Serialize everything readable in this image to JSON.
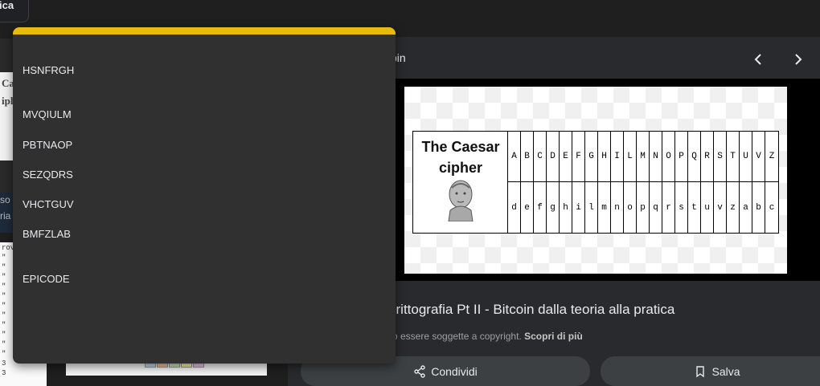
{
  "background": {
    "top_chip_text": "ica",
    "thumb1_lines": [
      "Ca",
      "iph"
    ],
    "thumb2_lines": [
      "so",
      "ria"
    ],
    "doc_lines": [
      "rova",
      "\"",
      "\"",
      "\"",
      "\"",
      "\"",
      "\"",
      "\"",
      "\"",
      "\"",
      "\"",
      "\"",
      "3",
      "3"
    ]
  },
  "dropdown": {
    "items": [
      "HSNFRGH",
      "MVQIULM",
      "PBTNAOP",
      "SEZQDRS",
      "VHCTGUV",
      "BMFZLAB",
      "EPICODE"
    ],
    "accent_color": "#e8b90f"
  },
  "panel": {
    "source_fragment": "pin",
    "prev_icon": "chevron-left-icon",
    "next_icon": "chevron-right-icon",
    "image": {
      "title": "The Caesar cipher",
      "plain": [
        "A",
        "B",
        "C",
        "D",
        "E",
        "F",
        "G",
        "H",
        "I",
        "L",
        "M",
        "N",
        "O",
        "P",
        "Q",
        "R",
        "S",
        "T",
        "U",
        "V",
        "Z"
      ],
      "cipher": [
        "d",
        "e",
        "f",
        "g",
        "h",
        "i",
        "l",
        "m",
        "n",
        "o",
        "p",
        "q",
        "r",
        "s",
        "t",
        "u",
        "v",
        "z",
        "a",
        "b",
        "c"
      ]
    },
    "result_title": "crittografia Pt II - Bitcoin dalla teoria alla pratica",
    "copyright_text": "ro essere soggette a copyright.",
    "learn_more": "Scopri di più",
    "share_label": "Condividi",
    "save_label": "Salva"
  }
}
